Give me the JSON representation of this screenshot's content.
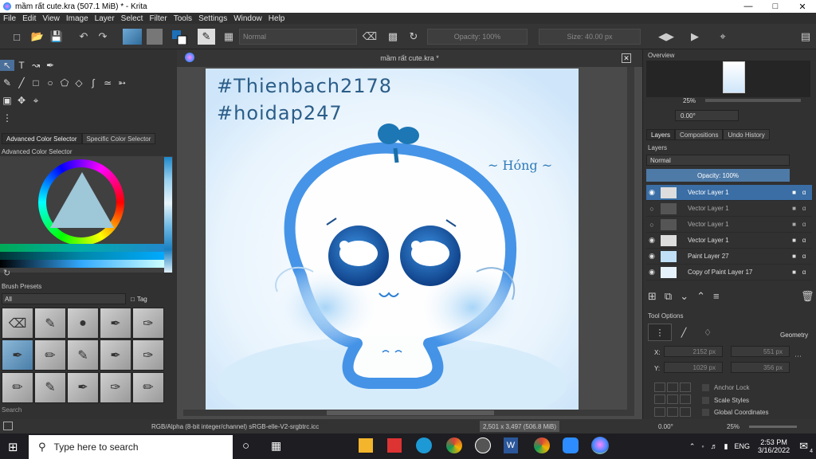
{
  "window": {
    "title": "mầm rất cute.kra (507.1 MiB)  * - Krita"
  },
  "menu": [
    "File",
    "Edit",
    "View",
    "Image",
    "Layer",
    "Select",
    "Filter",
    "Tools",
    "Settings",
    "Window",
    "Help"
  ],
  "toolbar": {
    "blend_mode": "Normal",
    "opacity": "Opacity: 100%",
    "size": "Size: 40.00 px"
  },
  "left": {
    "tabs": [
      "Advanced Color Selector",
      "Specific Color Selector"
    ],
    "color_title": "Advanced Color Selector",
    "brush_title": "Brush Presets",
    "brush_filter": "All",
    "tag_label": "Tag",
    "search_label": "Search"
  },
  "document": {
    "tab_title": "mầm rất cute.kra *"
  },
  "artwork": {
    "line1": "#Thienbach2178",
    "line2": "#hoidap247",
    "signature": "~ Hóng ~"
  },
  "right": {
    "overview_title": "Overview",
    "zoom": "25%",
    "rotation": "0.00°",
    "tabs": [
      "Layers",
      "Compositions",
      "Undo History"
    ],
    "layers_title": "Layers",
    "blend": "Normal",
    "opacity": "Opacity:  100%",
    "layers": [
      {
        "name": "Vector Layer 1",
        "selected": true
      },
      {
        "name": "Vector Layer 1",
        "selected": false
      },
      {
        "name": "Vector Layer 1",
        "selected": false
      },
      {
        "name": "Vector Layer 1",
        "selected": false
      },
      {
        "name": "Paint Layer 27",
        "selected": false
      },
      {
        "name": "Copy of Paint Layer 17",
        "selected": false
      }
    ],
    "tool_options_title": "Tool Options",
    "geometry_label": "Geometry",
    "x_label": "X:",
    "y_label": "Y:",
    "x_val": "2152 px",
    "y_val": "1029 px",
    "w_val": "551 px",
    "h_val": "356 px",
    "anchor": "Anchor Lock",
    "scale": "Scale Styles",
    "global": "Global Coordinates"
  },
  "status": {
    "colorspace": "RGB/Alpha (8-bit integer/channel)  sRGB-elle-V2-srgbtrc.icc",
    "dims": "2,501 x 3,497 (506.8 MiB)",
    "rotation": "0.00°",
    "zoom": "25%"
  },
  "taskbar": {
    "search": "Type here to search",
    "lang": "ENG",
    "time": "2:53 PM",
    "date": "3/16/2022",
    "notif": "4"
  }
}
